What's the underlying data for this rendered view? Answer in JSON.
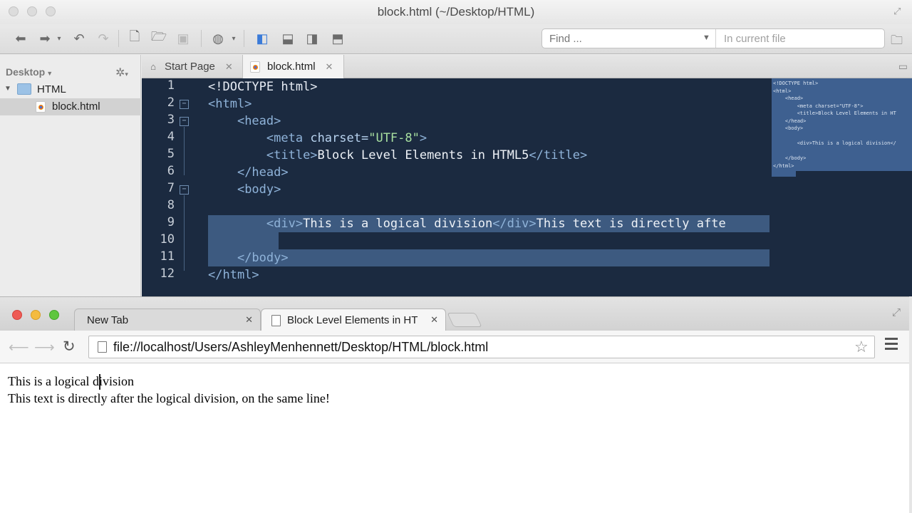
{
  "editor": {
    "window_title": "block.html (~/Desktop/HTML)",
    "find": {
      "placeholder": "Find ...",
      "scope": "In current file"
    },
    "sidebar": {
      "header": "Desktop",
      "tree": [
        {
          "label": "HTML",
          "type": "folder",
          "expanded": true
        },
        {
          "label": "block.html",
          "type": "file",
          "selected": true
        }
      ]
    },
    "tabs": [
      {
        "label": "Start Page",
        "icon": "home-icon",
        "active": false
      },
      {
        "label": "block.html",
        "icon": "chrome-file-icon",
        "active": true
      }
    ],
    "code_lines": [
      {
        "n": "1",
        "html": "<span class=\"tag\">&lt;!DOCTYPE html&gt;</span>"
      },
      {
        "n": "2",
        "html": "<span class=\"tagdim\">&lt;html&gt;</span>"
      },
      {
        "n": "3",
        "html": "    <span class=\"tagdim\">&lt;head&gt;</span>"
      },
      {
        "n": "4",
        "html": "        <span class=\"tagdim\">&lt;meta</span> <span class=\"attr\">charset=</span><span class=\"val\">\"UTF-8\"</span><span class=\"tagdim\">&gt;</span>"
      },
      {
        "n": "5",
        "html": "        <span class=\"tagdim\">&lt;title&gt;</span>Block Level Elements in HTML5<span class=\"tagdim\">&lt;/title&gt;</span>"
      },
      {
        "n": "6",
        "html": "    <span class=\"tagdim\">&lt;/head&gt;</span>"
      },
      {
        "n": "7",
        "html": "    <span class=\"tagdim\">&lt;body&gt;</span>"
      },
      {
        "n": "8",
        "html": ""
      },
      {
        "n": "9",
        "html": "        <span class=\"tagdim\">&lt;div&gt;</span>This is a logical division<span class=\"tagdim\">&lt;/div&gt;</span>This text is directly afte"
      },
      {
        "n": "10",
        "html": ""
      },
      {
        "n": "11",
        "html": "    <span class=\"tagdim\">&lt;/body&gt;</span>"
      },
      {
        "n": "12",
        "html": "<span class=\"tagdim\">&lt;/html&gt;</span>"
      }
    ],
    "minimap": [
      "<!DOCTYPE html>",
      "<html>",
      "    <head>",
      "        <meta charset=\"UTF-8\">",
      "        <title>Block Level Elements in HT",
      "    </head>",
      "    <body>",
      "",
      "        <div>This is a logical division</",
      "",
      "    </body>",
      "</html>"
    ]
  },
  "browser": {
    "tabs": [
      {
        "label": "New Tab",
        "active": false
      },
      {
        "label": "Block Level Elements in HT",
        "active": true
      }
    ],
    "url": "file://localhost/Users/AshleyMenhennett/Desktop/HTML/block.html",
    "content_lines": [
      "This is a logical division",
      "This text is directly after the logical division, on the same line!"
    ]
  },
  "colors": {
    "code_bg": "#1b2a40",
    "selection": "#3d5a80",
    "string": "#a8e0a0"
  }
}
